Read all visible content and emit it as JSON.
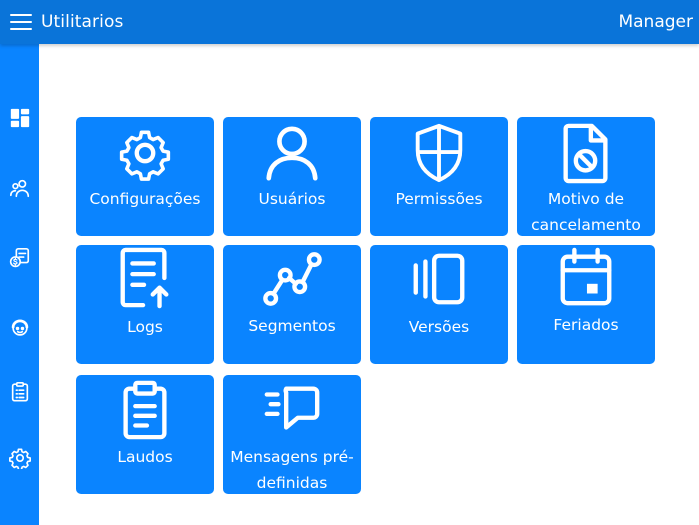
{
  "header": {
    "title": "Utilitarios",
    "user": "Manager"
  },
  "sidebar": {
    "items": [
      {
        "name": "dashboard-icon"
      },
      {
        "name": "users-icon"
      },
      {
        "name": "billing-icon"
      },
      {
        "name": "support-icon"
      },
      {
        "name": "clipboard-icon"
      },
      {
        "name": "gear-icon"
      }
    ]
  },
  "tiles": [
    {
      "label": "Configurações",
      "icon": "gear-icon"
    },
    {
      "label": "Usuários",
      "icon": "user-icon"
    },
    {
      "label": "Permissões",
      "icon": "shield-icon"
    },
    {
      "label": "Motivo de cancelamento",
      "icon": "file-cancel-icon"
    },
    {
      "label": "Logs",
      "icon": "document-upload-icon"
    },
    {
      "label": "Segmentos",
      "icon": "line-chart-icon"
    },
    {
      "label": "Versões",
      "icon": "versions-icon"
    },
    {
      "label": "Feriados",
      "icon": "calendar-icon"
    },
    {
      "label": "Laudos",
      "icon": "clipboard-icon"
    },
    {
      "label": "Mensagens pré-definidas",
      "icon": "message-icon"
    }
  ],
  "colors": {
    "header": "#0A74D9",
    "accent": "#0A84FF",
    "background": "#FFFFFF"
  }
}
